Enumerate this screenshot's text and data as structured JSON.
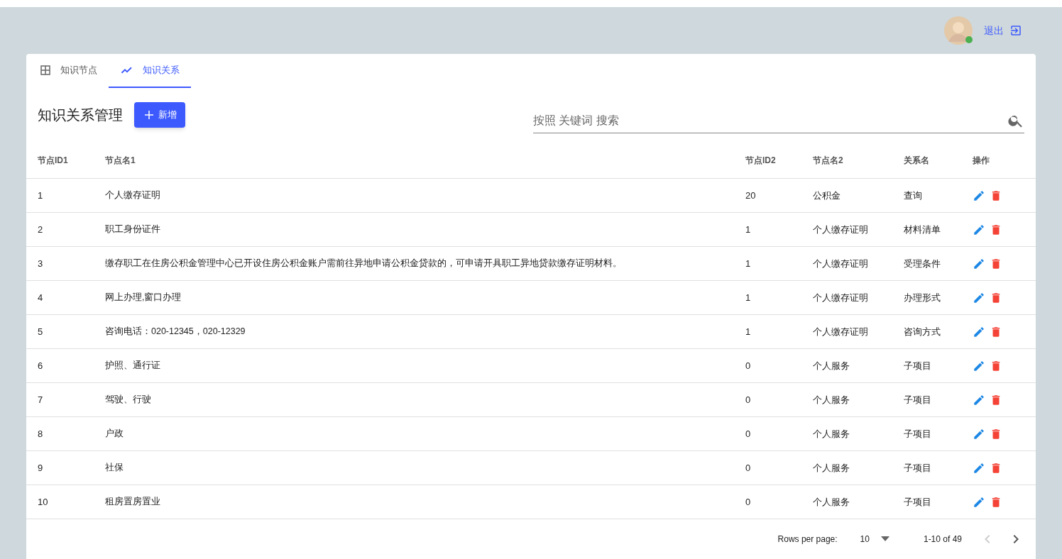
{
  "header": {
    "avatar": {
      "online": true
    },
    "logout": "退出"
  },
  "tabs": [
    {
      "label": "知识节点",
      "selected": false
    },
    {
      "label": "知识关系",
      "selected": true
    }
  ],
  "title": "知识关系管理",
  "add_button": "新增",
  "search": {
    "placeholder": "按照 关键词 搜索"
  },
  "table": {
    "columns": [
      "节点ID1",
      "节点名1",
      "节点ID2",
      "节点名2",
      "关系名",
      "操作"
    ],
    "rows": [
      {
        "id1": "1",
        "name1": "个人缴存证明",
        "id2": "20",
        "name2": "公积金",
        "relation": "查询"
      },
      {
        "id1": "2",
        "name1": "职工身份证件",
        "id2": "1",
        "name2": "个人缴存证明",
        "relation": "材料清单"
      },
      {
        "id1": "3",
        "name1": "缴存职工在住房公积金管理中心已开设住房公积金账户需前往异地申请公积金贷款的，可申请开具职工异地贷款缴存证明材料。",
        "id2": "1",
        "name2": "个人缴存证明",
        "relation": "受理条件"
      },
      {
        "id1": "4",
        "name1": "网上办理,窗口办理",
        "id2": "1",
        "name2": "个人缴存证明",
        "relation": "办理形式"
      },
      {
        "id1": "5",
        "name1": "咨询电话：020-12345，020-12329",
        "id2": "1",
        "name2": "个人缴存证明",
        "relation": "咨询方式"
      },
      {
        "id1": "6",
        "name1": "护照、通行证",
        "id2": "0",
        "name2": "个人服务",
        "relation": "子项目"
      },
      {
        "id1": "7",
        "name1": "驾驶、行驶",
        "id2": "0",
        "name2": "个人服务",
        "relation": "子项目"
      },
      {
        "id1": "8",
        "name1": "户政",
        "id2": "0",
        "name2": "个人服务",
        "relation": "子项目"
      },
      {
        "id1": "9",
        "name1": "社保",
        "id2": "0",
        "name2": "个人服务",
        "relation": "子项目"
      },
      {
        "id1": "10",
        "name1": "租房置房置业",
        "id2": "0",
        "name2": "个人服务",
        "relation": "子项目"
      }
    ]
  },
  "pagination": {
    "rows_per_page_label": "Rows per page:",
    "rows_per_page": "10",
    "range": "1-10 of 49",
    "prev_disabled": true,
    "next_disabled": false
  }
}
